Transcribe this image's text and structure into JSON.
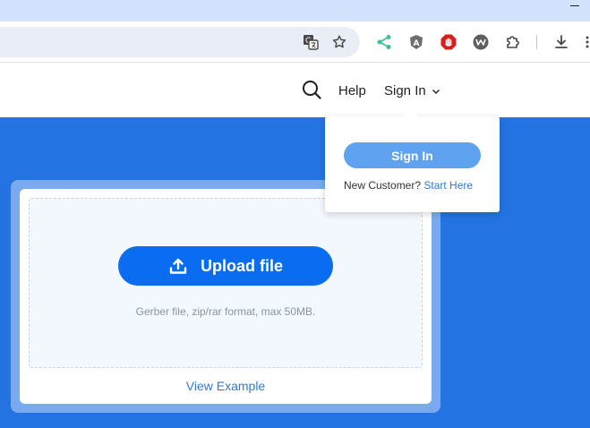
{
  "browser": {
    "icons": [
      "translate-icon",
      "bookmark-star-icon",
      "share-extension-icon",
      "extension-a-icon",
      "stop-extension-icon",
      "w-extension-icon",
      "puzzle-extensions-icon",
      "download-icon",
      "more-menu-icon"
    ]
  },
  "header": {
    "help_label": "Help",
    "signin_label": "Sign In"
  },
  "dropdown": {
    "signin_button": "Sign In",
    "new_customer_text": "New Customer?",
    "start_here_link": "Start Here"
  },
  "upload": {
    "button_label": "Upload file",
    "hint": "Gerber file, zip/rar format, max 50MB.",
    "view_example": "View Example"
  },
  "colors": {
    "hero_blue": "#2473e3",
    "upload_button": "#0a6cf0",
    "signin_button": "#5fa2ef",
    "link": "#2f7ad6"
  }
}
